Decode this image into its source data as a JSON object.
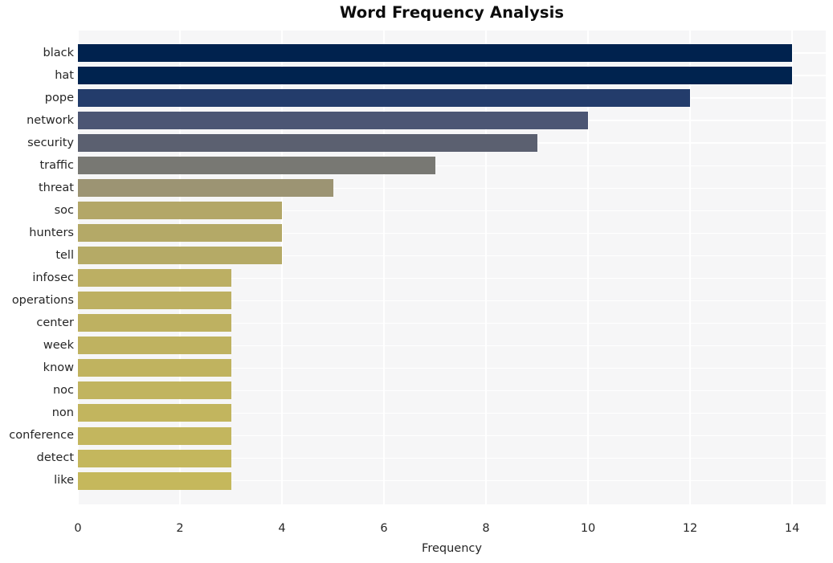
{
  "chart_data": {
    "type": "bar",
    "orientation": "horizontal",
    "title": "Word Frequency Analysis",
    "xlabel": "Frequency",
    "ylabel": "",
    "categories": [
      "black",
      "hat",
      "pope",
      "network",
      "security",
      "traffic",
      "threat",
      "soc",
      "hunters",
      "tell",
      "infosec",
      "operations",
      "center",
      "week",
      "know",
      "noc",
      "non",
      "conference",
      "detect",
      "like"
    ],
    "values": [
      14,
      14,
      12,
      10,
      9,
      7,
      5,
      4,
      4,
      4,
      3,
      3,
      3,
      3,
      3,
      3,
      3,
      3,
      3,
      3
    ],
    "bar_colors": [
      "#00224e",
      "#00234f",
      "#233c6b",
      "#4c5674",
      "#5b6070",
      "#787873",
      "#9c9473",
      "#b3a768",
      "#b4a967",
      "#b5aa66",
      "#bcaf63",
      "#bdb062",
      "#beb161",
      "#bfb260",
      "#c0b35f",
      "#c1b45f",
      "#c2b55e",
      "#c3b65e",
      "#c4b75d",
      "#c5b85c"
    ],
    "xticks": [
      0,
      2,
      4,
      6,
      8,
      10,
      12,
      14
    ],
    "xtick_labels": [
      "0",
      "2",
      "4",
      "6",
      "8",
      "10",
      "12",
      "14"
    ],
    "xlim": [
      0,
      14.66
    ],
    "grid": true,
    "legend": "none",
    "style": "seaborn-darkgrid",
    "plot_background": "#f6f6f7",
    "gridline_color": "#ffffff",
    "figure_background": "#ffffff",
    "text_color": "#262626",
    "title_color": "#0d0d0d"
  }
}
